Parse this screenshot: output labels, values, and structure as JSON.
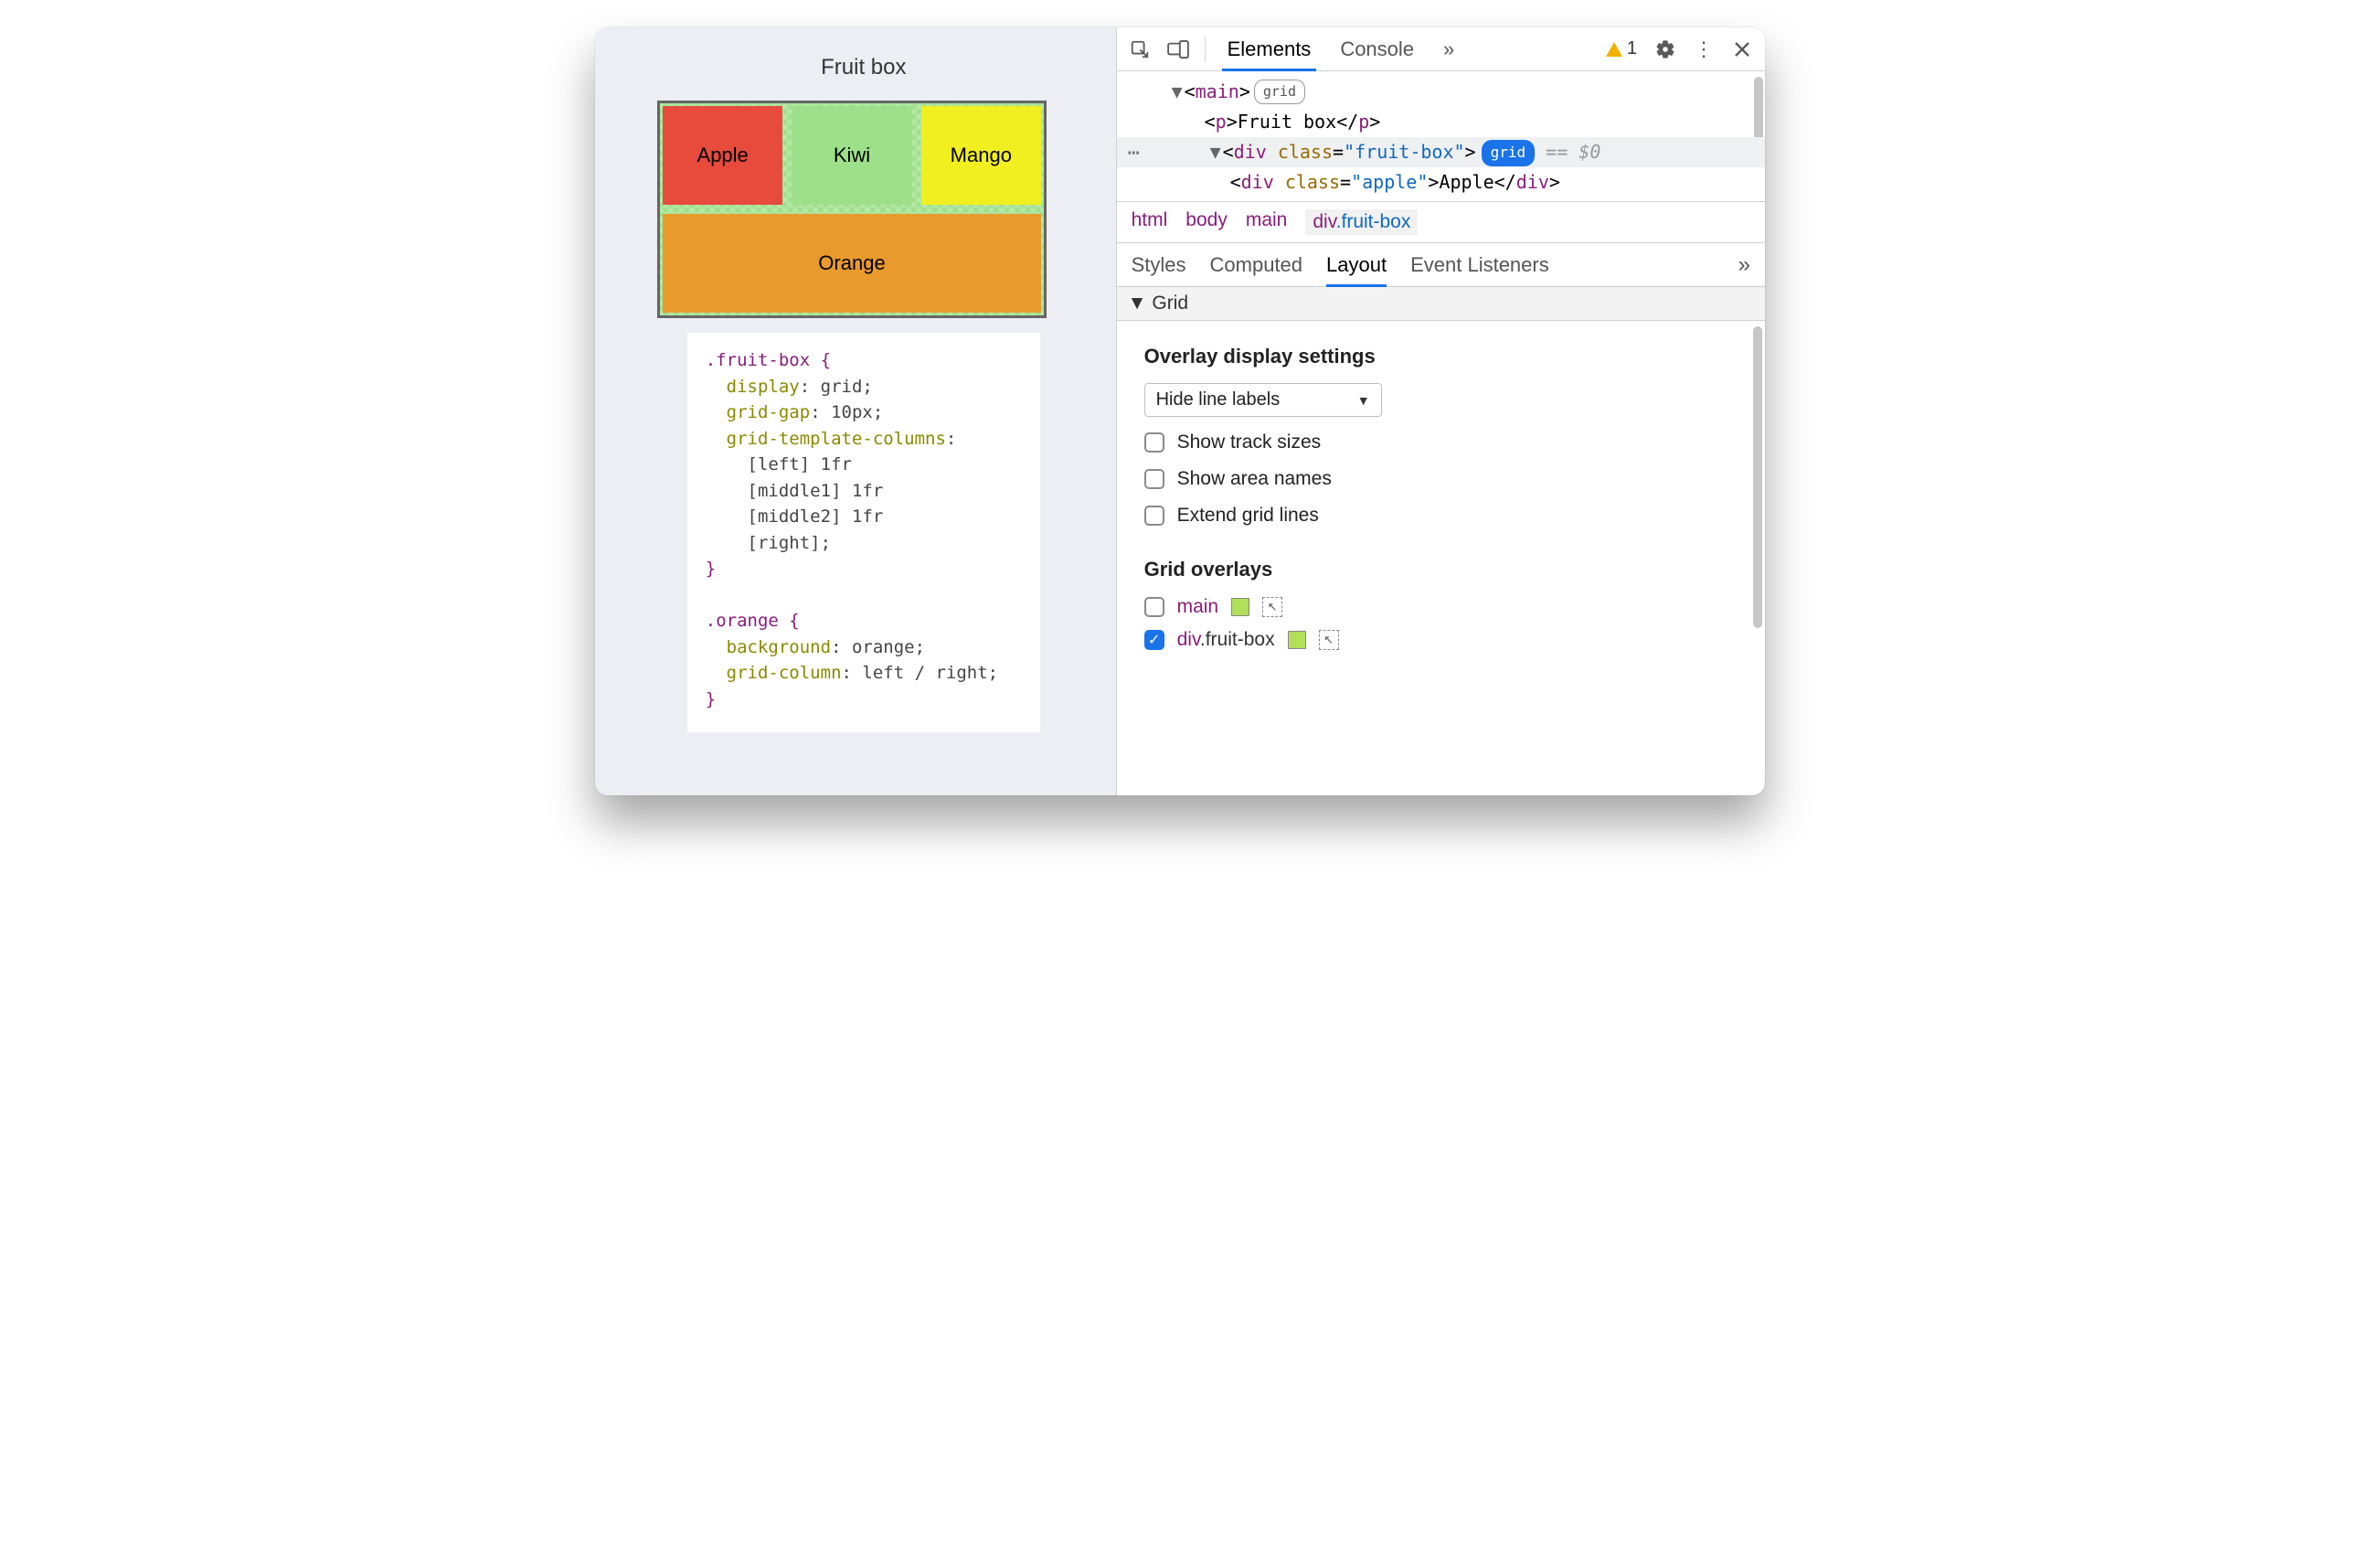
{
  "page": {
    "title": "Fruit box",
    "fruits": {
      "apple": "Apple",
      "kiwi": "Kiwi",
      "mango": "Mango",
      "orange": "Orange"
    },
    "css": {
      "rule1_selector": ".fruit-box {",
      "rule1_p1_prop": "  display",
      "rule1_p1_val": ": grid;",
      "rule1_p2_prop": "  grid-gap",
      "rule1_p2_val": ": 10px;",
      "rule1_p3_prop": "  grid-template-columns",
      "rule1_p3_end": ":",
      "rule1_l4": "    [left] 1fr",
      "rule1_l5": "    [middle1] 1fr",
      "rule1_l6": "    [middle2] 1fr",
      "rule1_l7": "    [right];",
      "rule1_close": "}",
      "blank": "",
      "rule2_selector": ".orange {",
      "rule2_p1_prop": "  background",
      "rule2_p1_val": ": orange;",
      "rule2_p2_prop": "  grid-column",
      "rule2_p2_val": ": left / right;",
      "rule2_close": "}"
    }
  },
  "toolbar": {
    "tab_elements": "Elements",
    "tab_console": "Console",
    "warn_count": "1"
  },
  "dom": {
    "main_open_tag": "main",
    "main_badge": "grid",
    "p_open": "p",
    "p_text": "Fruit box",
    "p_close": "p",
    "div_open": "div",
    "div_attr": "class",
    "div_val": "\"fruit-box\"",
    "div_badge": "grid",
    "div_tail": " == $0",
    "child_open": "div",
    "child_attr": "class",
    "child_val": "\"apple\"",
    "child_text": "Apple",
    "child_close": "div"
  },
  "crumbs": {
    "c1": "html",
    "c2": "body",
    "c3": "main",
    "c4_tag": "div",
    "c4_cls": ".fruit-box"
  },
  "subtabs": {
    "styles": "Styles",
    "computed": "Computed",
    "layout": "Layout",
    "listeners": "Event Listeners"
  },
  "layout": {
    "section": "Grid",
    "overlay_heading": "Overlay display settings",
    "select_value": "Hide line labels",
    "opt_track": "Show track sizes",
    "opt_area": "Show area names",
    "opt_extend": "Extend grid lines",
    "overlays_heading": "Grid overlays",
    "ov1_label": "main",
    "ov2_tag": "div",
    "ov2_cls": ".fruit-box"
  }
}
